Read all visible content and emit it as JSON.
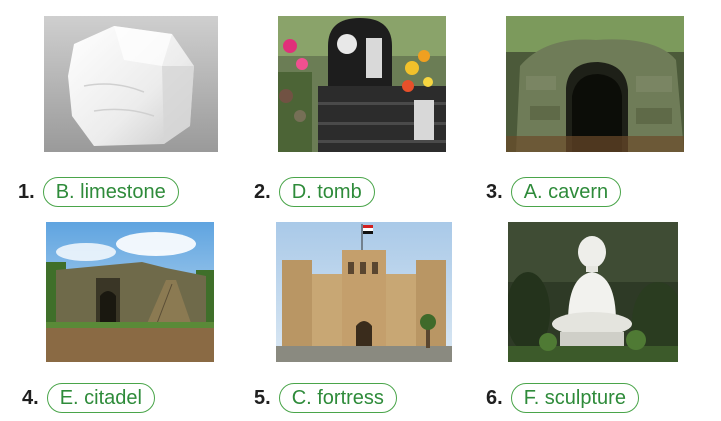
{
  "items": [
    {
      "number": "1.",
      "answer": "B. limestone",
      "image": "limestone-rock"
    },
    {
      "number": "2.",
      "answer": "D. tomb",
      "image": "tomb-with-flowers"
    },
    {
      "number": "3.",
      "answer": "A. cavern",
      "image": "stone-cavern"
    },
    {
      "number": "4.",
      "answer": "E. citadel",
      "image": "citadel-ruins"
    },
    {
      "number": "5.",
      "answer": "C. fortress",
      "image": "stone-fortress"
    },
    {
      "number": "6.",
      "answer": "F. sculpture",
      "image": "buddha-sculpture"
    }
  ],
  "colors": {
    "pill_border": "#4aa54a",
    "pill_text": "#2e8b3a",
    "number_text": "#1f1f1f"
  }
}
